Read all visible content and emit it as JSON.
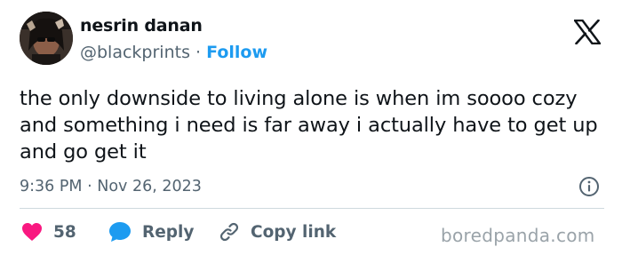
{
  "author": {
    "display_name": "nesrin danan",
    "handle": "@blackprints",
    "separator": "·",
    "follow_label": "Follow"
  },
  "tweet": {
    "text": "the only downside to living alone is when im soooo cozy and something i need is far away i actually have to get up and go get it",
    "time": "9:36 PM",
    "date": "Nov 26, 2023"
  },
  "actions": {
    "like_count": "58",
    "reply_label": "Reply",
    "copy_link_label": "Copy link"
  },
  "watermark": "boredpanda.com",
  "colors": {
    "accent": "#1d9bf0",
    "like": "#f91880",
    "secondary_text": "#536471"
  }
}
